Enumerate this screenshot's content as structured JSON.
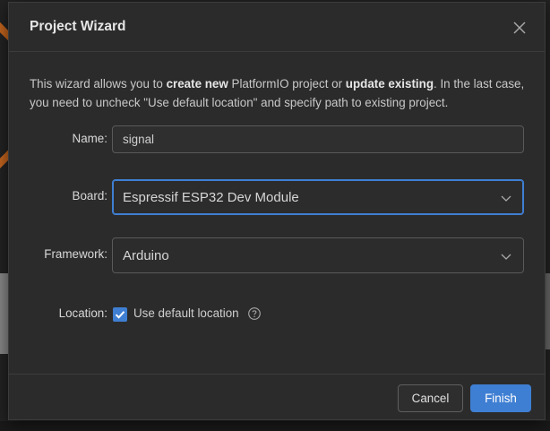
{
  "dialog": {
    "title": "Project Wizard",
    "intro": {
      "part1": "This wizard allows you to ",
      "bold1": "create new",
      "part2": " PlatformIO project or ",
      "bold2": "update existing",
      "part3": ". In the last case, you need to uncheck \"Use default location\" and specify path to existing project."
    },
    "fields": {
      "name": {
        "label": "Name",
        "value": "signal"
      },
      "board": {
        "label": "Board",
        "value": "Espressif ESP32 Dev Module"
      },
      "framework": {
        "label": "Framework",
        "value": "Arduino"
      },
      "location": {
        "label": "Location",
        "checkbox_label": "Use default location",
        "checked": true
      }
    },
    "buttons": {
      "cancel": "Cancel",
      "finish": "Finish"
    }
  },
  "colors": {
    "accent": "#3f7fd3",
    "dialog_bg": "#2b2b2b",
    "border": "#5a5a5a"
  },
  "icons": {
    "close": "close-icon",
    "chevron": "chevron-down-icon",
    "help": "help-circle-icon",
    "check": "checkmark-icon"
  }
}
